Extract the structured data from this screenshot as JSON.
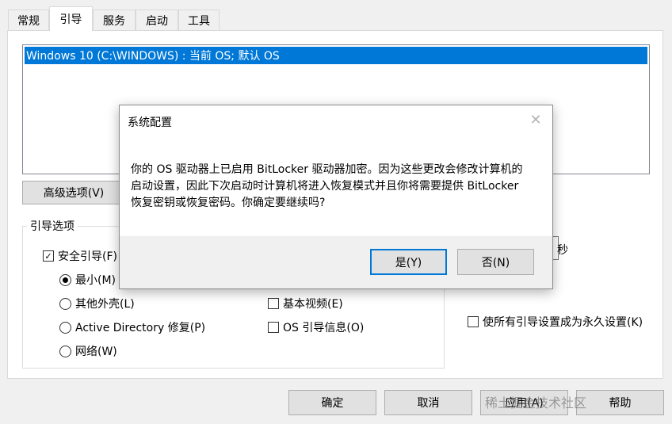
{
  "tabs": [
    "常规",
    "引导",
    "服务",
    "启动",
    "工具"
  ],
  "os_list": {
    "entries": [
      "Windows 10 (C:\\WINDOWS) : 当前 OS; 默认 OS"
    ]
  },
  "buttons": {
    "advanced": "高级选项(V)",
    "ok": "确定",
    "cancel": "取消",
    "apply": "应用(A)",
    "help": "帮助"
  },
  "boot_options": {
    "group_title": "引导选项",
    "safe_boot": "安全引导(F)",
    "minimal": "最小(M)",
    "alternate_shell": "其他外壳(L)",
    "active_directory": "Active Directory 修复(P)",
    "network": "网络(W)",
    "base_video": "基本视频(E)",
    "os_boot_info": "OS 引导信息(O)"
  },
  "timeout_unit": "秒",
  "make_permanent": "使所有引导设置成为永久设置(K)",
  "dialog": {
    "title": "系统配置",
    "message_lines": [
      "你的 OS 驱动器上已启用 BitLocker 驱动器加密。因为这些更改会修改计算机的",
      "启动设置，因此下次启动时计算机将进入恢复模式并且你将需要提供 BitLocker",
      "恢复密钥或恢复密码。你确定要继续吗?"
    ],
    "yes": "是(Y)",
    "no": "否(N)",
    "close_glyph": "✕"
  },
  "watermark": "稀土掘金技术社区",
  "colors": {
    "selection": "#0078d7",
    "button_face": "#e1e1e1",
    "dialog_footer": "#f0f0f0"
  },
  "icons": {
    "checked": "✓",
    "close": "close-icon"
  }
}
